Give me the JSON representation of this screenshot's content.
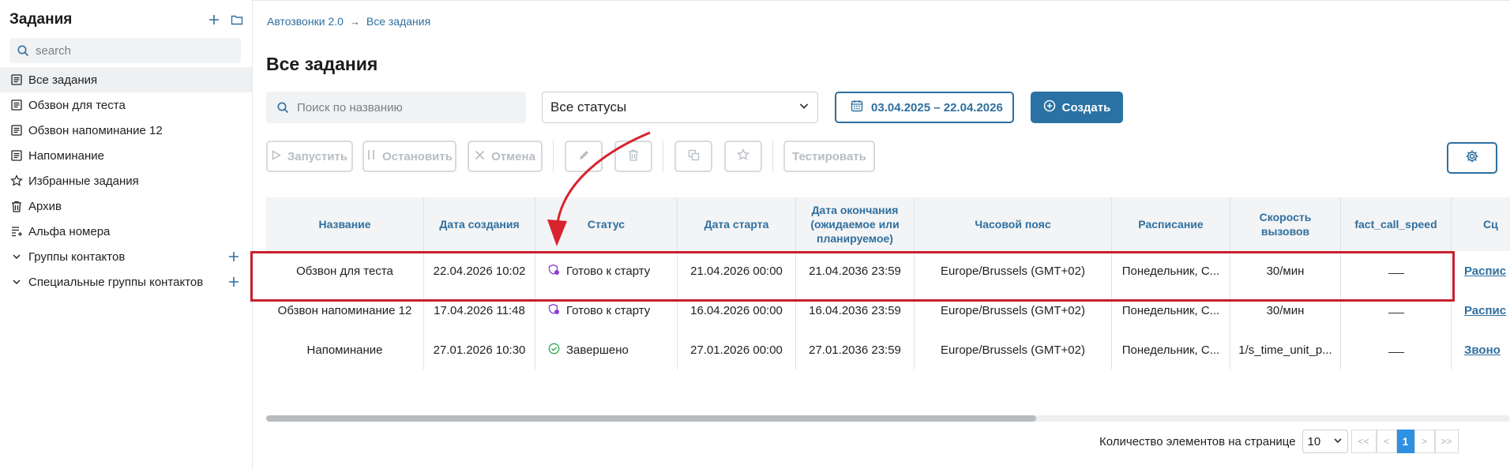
{
  "sidebar": {
    "title": "Задания",
    "search_placeholder": "search",
    "items": [
      {
        "label": "Все задания"
      },
      {
        "label": "Обзвон для теста"
      },
      {
        "label": "Обзвон напоминание 12"
      },
      {
        "label": "Напоминание"
      },
      {
        "label": "Избранные задания"
      },
      {
        "label": "Архив"
      },
      {
        "label": "Альфа номера"
      },
      {
        "label": "Группы контактов"
      },
      {
        "label": "Специальные группы контактов"
      }
    ]
  },
  "breadcrumb": {
    "root": "Автозвонки 2.0",
    "current": "Все задания"
  },
  "page_title": "Все задания",
  "filters": {
    "search_placeholder": "Поиск по названию",
    "status_value": "Все статусы",
    "date_range": "03.04.2025 – 22.04.2026",
    "create_label": "Создать"
  },
  "toolbar": {
    "start_label": "Запустить",
    "stop_label": "Остановить",
    "cancel_label": "Отмена",
    "test_label": "Тестировать"
  },
  "table": {
    "headers": {
      "name": "Название",
      "created": "Дата создания",
      "status": "Статус",
      "start": "Дата старта",
      "end": "Дата окончания (ожидаемое или планируемое)",
      "tz": "Часовой пояс",
      "schedule": "Расписание",
      "speed": "Скорость вызовов",
      "fact": "fact_call_speed",
      "scenario": "Сц"
    },
    "rows": [
      {
        "name": "Обзвон для теста",
        "created": "22.04.2026 10:02",
        "status": "Готово к старту",
        "start": "21.04.2026 00:00",
        "end": "21.04.2036 23:59",
        "tz": "Europe/Brussels (GMT+02)",
        "schedule": "Понедельник, С...",
        "speed": "30/мин",
        "scenario": "Распис"
      },
      {
        "name": "Обзвон напоминание 12",
        "created": "17.04.2026 11:48",
        "status": "Готово к старту",
        "start": "16.04.2026 00:00",
        "end": "16.04.2036 23:59",
        "tz": "Europe/Brussels (GMT+02)",
        "schedule": "Понедельник, С...",
        "speed": "30/мин",
        "scenario": "Распис"
      },
      {
        "name": "Напоминание",
        "created": "27.01.2026 10:30",
        "status": "Завершено",
        "start": "27.01.2026 00:00",
        "end": "27.01.2036 23:59",
        "tz": "Europe/Brussels (GMT+02)",
        "schedule": "Понедельник, С...",
        "speed": "1/s_time_unit_p...",
        "scenario": "Звоно"
      }
    ]
  },
  "pagination": {
    "label": "Количество элементов на странице",
    "per_page": "10",
    "first": "<<",
    "prev": "<",
    "current": "1",
    "next": ">",
    "last": ">>"
  },
  "colors": {
    "accent": "#2f6f9f",
    "create_bg": "#2a72a3",
    "highlight": "#c8202e",
    "ready_status": "#8a3fd1",
    "done_status": "#2fa84f"
  }
}
